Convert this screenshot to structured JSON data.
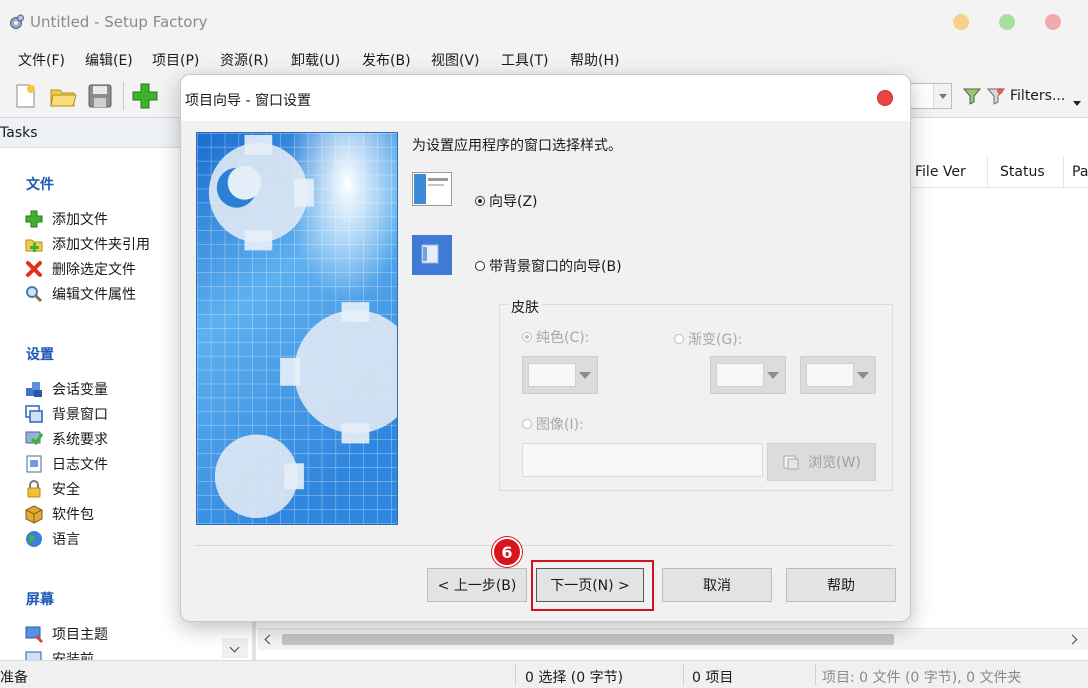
{
  "window": {
    "title": "Untitled - Setup Factory",
    "icon": "setup-factory-gear-icon"
  },
  "menu": [
    "文件(F)",
    "编辑(E)",
    "项目(P)",
    "资源(R)",
    "卸载(U)",
    "发布(B)",
    "视图(V)",
    "工具(T)",
    "帮助(H)"
  ],
  "toolbar": {
    "icons": [
      "new-project-icon",
      "open-folder-icon",
      "save-icon",
      "add-files-icon"
    ],
    "filters_label": "Filters..."
  },
  "tasks": {
    "title": "Tasks",
    "groups": [
      {
        "title": "文件",
        "items": [
          {
            "label": "添加文件",
            "icon": "add-file-icon"
          },
          {
            "label": "添加文件夹引用",
            "icon": "add-folder-reference-icon"
          },
          {
            "label": "删除选定文件",
            "icon": "delete-file-icon"
          },
          {
            "label": "编辑文件属性",
            "icon": "file-properties-icon"
          }
        ]
      },
      {
        "title": "设置",
        "items": [
          {
            "label": "会话变量",
            "icon": "session-variables-icon"
          },
          {
            "label": "背景窗口",
            "icon": "background-window-icon"
          },
          {
            "label": "系统要求",
            "icon": "system-requirements-icon"
          },
          {
            "label": "日志文件",
            "icon": "log-file-icon"
          },
          {
            "label": "安全",
            "icon": "security-lock-icon"
          },
          {
            "label": "软件包",
            "icon": "package-icon"
          },
          {
            "label": "语言",
            "icon": "language-globe-icon"
          }
        ]
      },
      {
        "title": "屏幕",
        "items": [
          {
            "label": "项目主题",
            "icon": "project-theme-icon"
          },
          {
            "label": "安装前",
            "icon": "before-install-icon"
          }
        ]
      }
    ]
  },
  "file_list": {
    "columns": [
      "File Ver",
      "Status",
      "Pa"
    ]
  },
  "status_bar": {
    "ready": "准备",
    "selection": "0 选择 (0 字节)",
    "items": "0 项目",
    "project": "项目: 0 文件 (0 字节), 0 文件夹"
  },
  "dialog": {
    "title": "项目向导 - 窗口设置",
    "heading": "为设置应用程序的窗口选择样式。",
    "option_wizard": "向导(Z)",
    "option_wizard_bg": "带背景窗口的向导(B)",
    "skin": {
      "title": "皮肤",
      "solid": "纯色(C):",
      "gradient": "渐变(G):",
      "image": "图像(I):",
      "browse": "浏览(W)"
    },
    "buttons": {
      "back": "< 上一步(B)",
      "next": "下一页(N) >",
      "cancel": "取消",
      "help": "帮助"
    },
    "step_badge": "6",
    "colors": {
      "highlight": "#d0131b",
      "badge": "#d8141c",
      "group_title": "#1d58b5"
    }
  }
}
